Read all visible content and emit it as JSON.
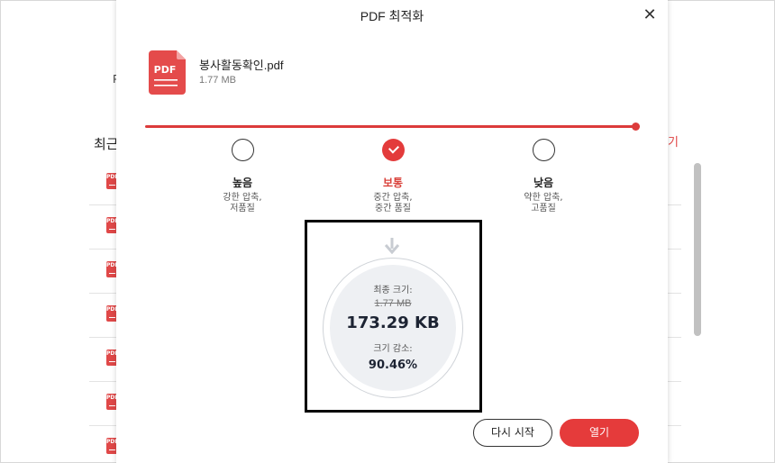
{
  "background": {
    "side_label": "P",
    "recent_title": "최근",
    "link_fragment": "기",
    "rows": [
      {
        "icon": "PDF"
      },
      {
        "icon": "PDF"
      },
      {
        "icon": "PDF"
      },
      {
        "icon": "PDF"
      },
      {
        "icon": "PDF"
      },
      {
        "icon": "PDF"
      },
      {
        "icon": "PDF"
      }
    ]
  },
  "dialog": {
    "title": "PDF 최적화",
    "close_icon": "close-icon",
    "file": {
      "icon_label": "PDF",
      "name": "봉사활동확인.pdf",
      "size": "1.77 MB"
    },
    "options": [
      {
        "title": "높음",
        "desc_line1": "강한 압축,",
        "desc_line2": "저품질",
        "checked": false
      },
      {
        "title": "보통",
        "desc_line1": "중간 압축,",
        "desc_line2": "중간 품질",
        "checked": true
      },
      {
        "title": "낮음",
        "desc_line1": "약한 압축,",
        "desc_line2": "고품질",
        "checked": false
      }
    ],
    "result": {
      "final_label": "최종 크기:",
      "original_size": "1.77 MB",
      "final_size": "173.29 KB",
      "reduction_label": "크기 감소:",
      "reduction_value": "90.46%"
    },
    "buttons": {
      "restart": "다시 시작",
      "open": "열기"
    },
    "colors": {
      "accent": "#e53b3b",
      "accent_text": "#d9413a"
    }
  }
}
